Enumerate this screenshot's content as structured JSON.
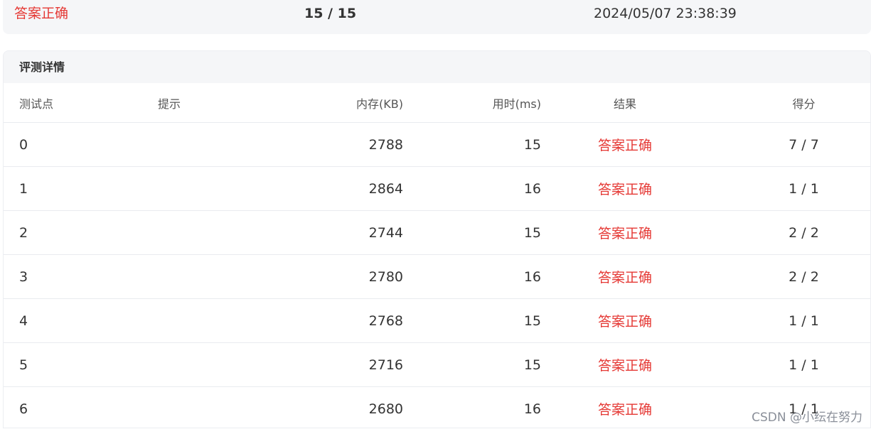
{
  "summary": {
    "status": "答案正确",
    "score": "15 / 15",
    "submitted_at": "2024/05/07 23:38:39"
  },
  "details": {
    "title": "评测详情",
    "columns": {
      "test_point": "测试点",
      "hint": "提示",
      "memory": "内存(KB)",
      "time": "用时(ms)",
      "result": "结果",
      "score": "得分"
    },
    "rows": [
      {
        "id": "0",
        "hint": "",
        "memory": "2788",
        "time": "15",
        "result": "答案正确",
        "score": "7 / 7"
      },
      {
        "id": "1",
        "hint": "",
        "memory": "2864",
        "time": "16",
        "result": "答案正确",
        "score": "1 / 1"
      },
      {
        "id": "2",
        "hint": "",
        "memory": "2744",
        "time": "15",
        "result": "答案正确",
        "score": "2 / 2"
      },
      {
        "id": "3",
        "hint": "",
        "memory": "2780",
        "time": "16",
        "result": "答案正确",
        "score": "2 / 2"
      },
      {
        "id": "4",
        "hint": "",
        "memory": "2768",
        "time": "15",
        "result": "答案正确",
        "score": "1 / 1"
      },
      {
        "id": "5",
        "hint": "",
        "memory": "2716",
        "time": "15",
        "result": "答案正确",
        "score": "1 / 1"
      },
      {
        "id": "6",
        "hint": "",
        "memory": "2680",
        "time": "16",
        "result": "答案正确",
        "score": "1 / 1"
      }
    ]
  },
  "watermark": "CSDN @小纭在努力",
  "colors": {
    "accepted": "#e53935",
    "header_bg": "#f5f6f8",
    "divider": "#e9ebef"
  }
}
